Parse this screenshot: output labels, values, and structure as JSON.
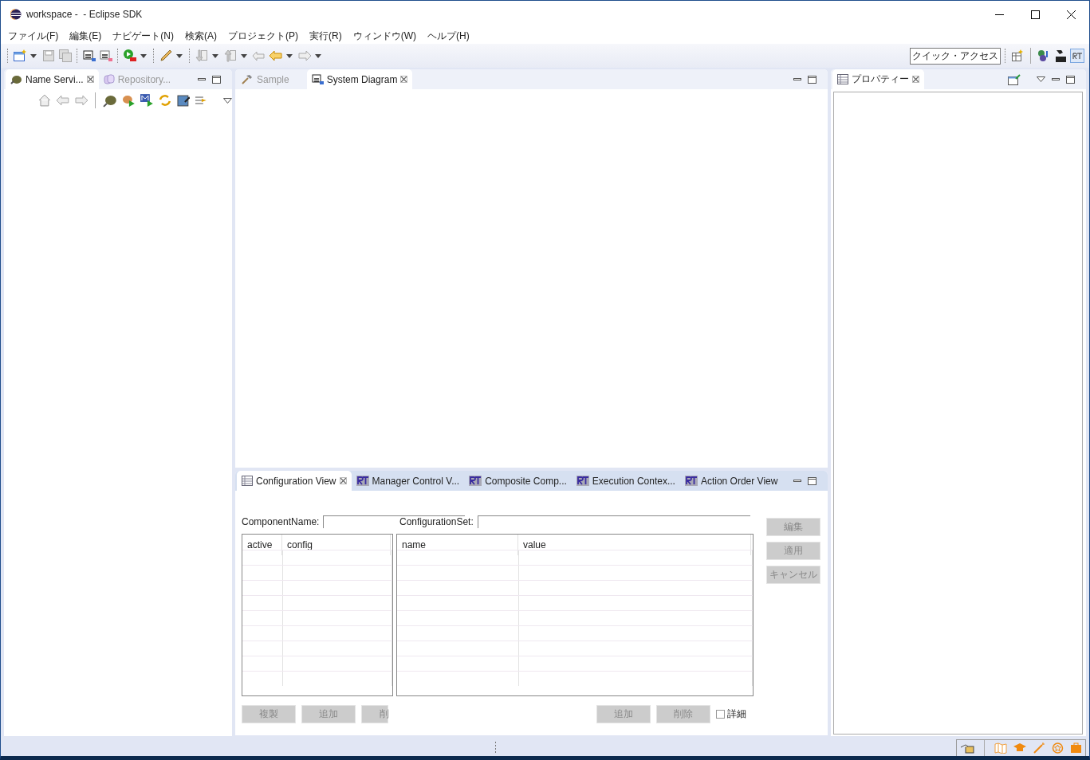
{
  "window": {
    "title": "workspace -  - Eclipse SDK"
  },
  "menu": [
    "ファイル(F)",
    "編集(E)",
    "ナビゲート(N)",
    "検索(A)",
    "プロジェクト(P)",
    "実行(R)",
    "ウィンドウ(W)",
    "ヘルプ(H)"
  ],
  "toolbar": {
    "quick_access": "クイック・アクセス"
  },
  "left_panel": {
    "tabs": [
      {
        "label": "Name Servi...",
        "selected": true
      },
      {
        "label": "Repository...",
        "selected": false
      }
    ]
  },
  "editor": {
    "tabs": [
      {
        "label": "Sample",
        "selected": false
      },
      {
        "label": "System Diagram",
        "selected": true
      }
    ]
  },
  "properties_panel": {
    "tabs": [
      {
        "label": "プロパティー",
        "selected": true
      }
    ]
  },
  "bottom_panel": {
    "tabs": [
      {
        "label": "Configuration View",
        "selected": true,
        "kind": "table"
      },
      {
        "label": "Manager Control V...",
        "selected": false,
        "kind": "rt"
      },
      {
        "label": "Composite Comp...",
        "selected": false,
        "kind": "rt"
      },
      {
        "label": "Execution Contex...",
        "selected": false,
        "kind": "rt"
      },
      {
        "label": "Action Order View",
        "selected": false,
        "kind": "rt"
      }
    ],
    "component_name_label": "ComponentName:",
    "configuration_set_label": "ConfigurationSet:",
    "config_table": {
      "columns": [
        "active",
        "config"
      ]
    },
    "param_table": {
      "columns": [
        "name",
        "value"
      ]
    },
    "side_buttons": [
      {
        "label": "編集",
        "disabled": true
      },
      {
        "label": "適用",
        "disabled": true
      },
      {
        "label": "キャンセル",
        "disabled": true
      }
    ],
    "left_buttons": [
      {
        "label": "複製",
        "disabled": true
      },
      {
        "label": "追加",
        "disabled": true
      },
      {
        "label": "削",
        "disabled": true
      }
    ],
    "right_buttons": [
      {
        "label": "追加",
        "disabled": true
      },
      {
        "label": "削除",
        "disabled": true
      }
    ],
    "detail_checkbox": {
      "label": "詳細",
      "checked": false
    }
  }
}
